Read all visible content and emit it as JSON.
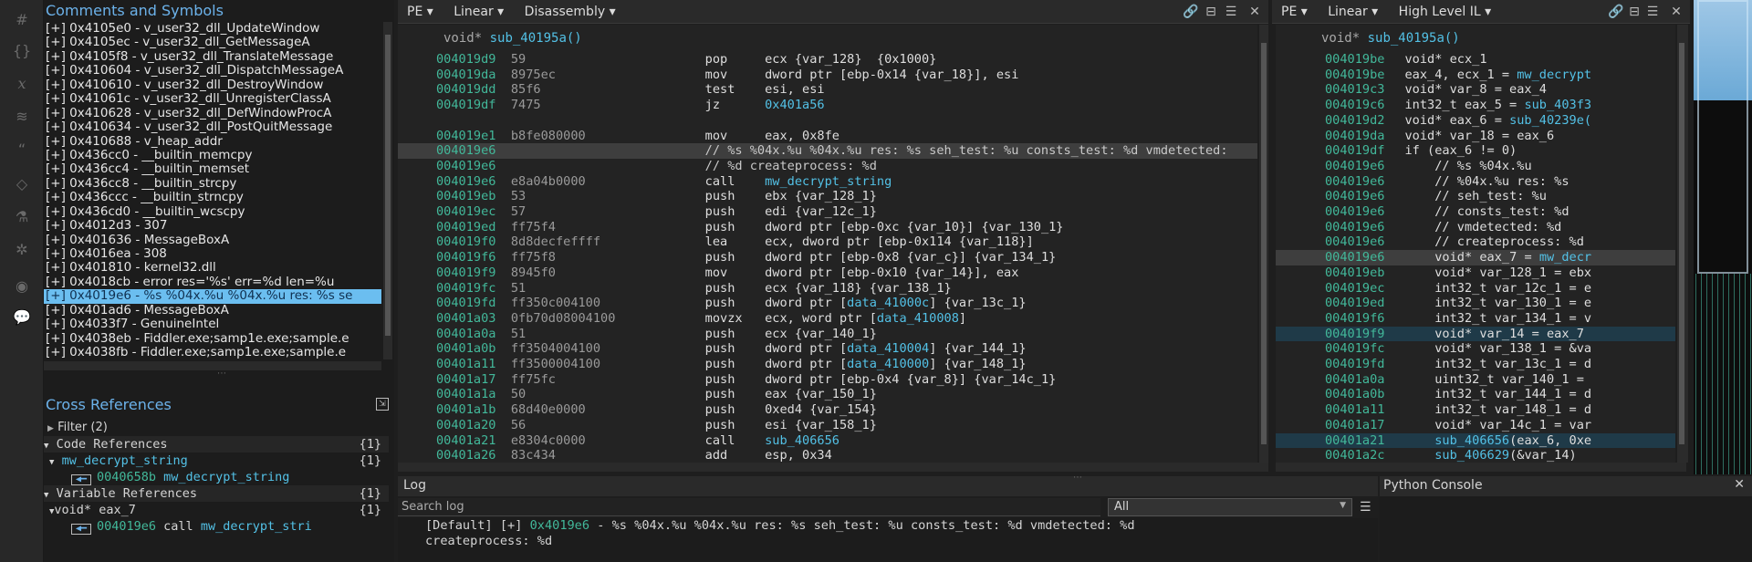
{
  "rail_icons": [
    "#",
    "{}",
    "x",
    "layers",
    "quote",
    "tag",
    "flask",
    "bug",
    "toggle",
    "comment"
  ],
  "comments": {
    "title": "Comments and Symbols",
    "items": [
      "[+] 0x4105e0 - v_user32_dll_UpdateWindow",
      "[+] 0x4105ec - v_user32_dll_GetMessageA",
      "[+] 0x4105f8 - v_user32_dll_TranslateMessage",
      "[+] 0x410604 - v_user32_dll_DispatchMessageA",
      "[+] 0x410610 - v_user32_dll_DestroyWindow",
      "[+] 0x41061c - v_user32_dll_UnregisterClassA",
      "[+] 0x410628 - v_user32_dll_DefWindowProcA",
      "[+] 0x410634 - v_user32_dll_PostQuitMessage",
      "[+] 0x410688 - v_heap_addr",
      "[+] 0x436cc0 - __builtin_memcpy",
      "[+] 0x436cc4 - __builtin_memset",
      "[+] 0x436cc8 - __builtin_strcpy",
      "[+] 0x436ccc - __builtin_strncpy",
      "[+] 0x436cd0 - __builtin_wcscpy",
      "[+] 0x4012d3 - 307",
      "[+] 0x401636 - MessageBoxA",
      "[+] 0x4016ea - 308",
      "[+] 0x401810 - kernel32.dll",
      "[+] 0x4018cb - error res='%s' err=%d len=%u",
      "[+] 0x4019e6 - %s %04x.%u %04x.%u res: %s se",
      "[+] 0x401ad6 - MessageBoxA",
      "[+] 0x4033f7 - GenuineIntel",
      "[+] 0x4038eb - Fiddler.exe;samp1e.exe;sample.e",
      "[+] 0x4038fb - Fiddler.exe;samp1e.exe;sample.e"
    ],
    "selected_index": 19
  },
  "xrefs": {
    "title": "Cross References",
    "filter": "Filter (2)",
    "code_refs_label": "Code References",
    "code_refs_count": "{1}",
    "code_fn": "mw_decrypt_string",
    "code_fn_count": "{1}",
    "code_ref_addr": "0040658b",
    "code_ref_name": "mw_decrypt_string",
    "var_refs_label": "Variable References",
    "var_refs_count": "{1}",
    "var_name": "void* eax_7",
    "var_count": "{1}",
    "var_ref_addr": "004019e6",
    "var_ref_op": "call",
    "var_ref_target": "mw_decrypt_stri"
  },
  "disasm": {
    "menu_pe": "PE ▾",
    "menu_linear": "Linear ▾",
    "menu_view": "Disassembly ▾",
    "signature_kw": "void*",
    "signature_fn": "sub_40195a()",
    "rows": [
      {
        "a": "004019d9",
        "b": "59",
        "m": "pop",
        "o": [
          [
            "ecx {var_128}  {0x1000}",
            ""
          ]
        ]
      },
      {
        "a": "004019da",
        "b": "8975ec",
        "m": "mov",
        "o": [
          [
            "dword ptr [ebp-0x14 {var_18}], esi",
            ""
          ]
        ]
      },
      {
        "a": "004019dd",
        "b": "85f6",
        "m": "test",
        "o": [
          [
            "esi, esi",
            ""
          ]
        ]
      },
      {
        "a": "004019df",
        "b": "7475",
        "m": "jz",
        "o": [
          [
            "0x401a56",
            "cyan"
          ]
        ]
      },
      {
        "a": "",
        "b": "",
        "m": "",
        "o": []
      },
      {
        "a": "004019e1",
        "b": "b8fe080000",
        "m": "mov",
        "o": [
          [
            "eax, 0x8fe",
            ""
          ]
        ]
      },
      {
        "a": "004019e6",
        "b": "",
        "m": "",
        "o": [
          [
            "// %s %04x.%u %04x.%u res: %s seh_test: %u consts_test: %d vmdetected:",
            "cmt"
          ]
        ],
        "hl": "hl"
      },
      {
        "a": "004019e6",
        "b": "",
        "m": "",
        "o": [
          [
            "// %d createprocess: %d",
            "cmt"
          ]
        ]
      },
      {
        "a": "004019e6",
        "b": "e8a04b0000",
        "m": "call",
        "o": [
          [
            "mw_decrypt_string",
            "cyan"
          ]
        ]
      },
      {
        "a": "004019eb",
        "b": "53",
        "m": "push",
        "o": [
          [
            "ebx {var_128_1}",
            ""
          ]
        ]
      },
      {
        "a": "004019ec",
        "b": "57",
        "m": "push",
        "o": [
          [
            "edi {var_12c_1}",
            ""
          ]
        ]
      },
      {
        "a": "004019ed",
        "b": "ff75f4",
        "m": "push",
        "o": [
          [
            "dword ptr [ebp-0xc {var_10}] {var_130_1}",
            ""
          ]
        ]
      },
      {
        "a": "004019f0",
        "b": "8d8decfeffff",
        "m": "lea",
        "o": [
          [
            "ecx, dword ptr [ebp-0x114 {var_118}]",
            ""
          ]
        ]
      },
      {
        "a": "004019f6",
        "b": "ff75f8",
        "m": "push",
        "o": [
          [
            "dword ptr [ebp-0x8 {var_c}] {var_134_1}",
            ""
          ]
        ]
      },
      {
        "a": "004019f9",
        "b": "8945f0",
        "m": "mov",
        "o": [
          [
            "dword ptr [ebp-0x10 {var_14}], eax",
            ""
          ]
        ]
      },
      {
        "a": "004019fc",
        "b": "51",
        "m": "push",
        "o": [
          [
            "ecx {var_118} {var_138_1}",
            ""
          ]
        ]
      },
      {
        "a": "004019fd",
        "b": "ff350c004100",
        "m": "push",
        "o": [
          [
            "dword ptr [",
            ""
          ],
          [
            "data_41000c",
            "cyan"
          ],
          [
            "] {var_13c_1}",
            ""
          ]
        ]
      },
      {
        "a": "00401a03",
        "b": "0fb70d08004100",
        "m": "movzx",
        "o": [
          [
            "ecx, word ptr [",
            ""
          ],
          [
            "data_410008",
            "cyan"
          ],
          [
            "]",
            ""
          ]
        ]
      },
      {
        "a": "00401a0a",
        "b": "51",
        "m": "push",
        "o": [
          [
            "ecx {var_140_1}",
            ""
          ]
        ]
      },
      {
        "a": "00401a0b",
        "b": "ff3504004100",
        "m": "push",
        "o": [
          [
            "dword ptr [",
            ""
          ],
          [
            "data_410004",
            "cyan"
          ],
          [
            "] {var_144_1}",
            ""
          ]
        ]
      },
      {
        "a": "00401a11",
        "b": "ff3500004100",
        "m": "push",
        "o": [
          [
            "dword ptr [",
            ""
          ],
          [
            "data_410000",
            "cyan"
          ],
          [
            "] {var_148_1}",
            ""
          ]
        ]
      },
      {
        "a": "00401a17",
        "b": "ff75fc",
        "m": "push",
        "o": [
          [
            "dword ptr [ebp-0x4 {var_8}] {var_14c_1}",
            ""
          ]
        ]
      },
      {
        "a": "00401a1a",
        "b": "50",
        "m": "push",
        "o": [
          [
            "eax {var_150_1}",
            ""
          ]
        ]
      },
      {
        "a": "00401a1b",
        "b": "68d40e0000",
        "m": "push",
        "o": [
          [
            "0xed4 {var_154}",
            ""
          ]
        ]
      },
      {
        "a": "00401a20",
        "b": "56",
        "m": "push",
        "o": [
          [
            "esi {var_158_1}",
            ""
          ]
        ]
      },
      {
        "a": "00401a21",
        "b": "e8304c0000",
        "m": "call",
        "o": [
          [
            "sub_406656",
            "cyan"
          ]
        ]
      },
      {
        "a": "00401a26",
        "b": "83c434",
        "m": "add",
        "o": [
          [
            "esp, 0x34",
            ""
          ]
        ]
      }
    ]
  },
  "hlil": {
    "menu_pe": "PE ▾",
    "menu_linear": "Linear ▾",
    "menu_view": "High Level IL ▾",
    "signature_kw": "void*",
    "signature_fn": "sub_40195a()",
    "rows": [
      {
        "a": "004019be",
        "t": [
          [
            "void* ecx_1",
            ""
          ]
        ],
        "i": 0
      },
      {
        "a": "004019be",
        "t": [
          [
            "eax_4, ecx_1 = ",
            ""
          ],
          [
            "mw_decrypt",
            "cyan"
          ]
        ],
        "i": 0
      },
      {
        "a": "004019c3",
        "t": [
          [
            "void* var_8 = eax_4",
            ""
          ]
        ],
        "i": 0
      },
      {
        "a": "004019c6",
        "t": [
          [
            "int32_t eax_5 = ",
            ""
          ],
          [
            "sub_403f3",
            "cyan"
          ]
        ],
        "i": 0
      },
      {
        "a": "004019d2",
        "t": [
          [
            "void* eax_6 = ",
            ""
          ],
          [
            "sub_40239e(",
            "cyan"
          ]
        ],
        "i": 0
      },
      {
        "a": "004019da",
        "t": [
          [
            "void* var_18 = eax_6",
            ""
          ]
        ],
        "i": 0
      },
      {
        "a": "004019df",
        "t": [
          [
            "if (eax_6 != 0)",
            ""
          ]
        ],
        "i": 0
      },
      {
        "a": "004019e6",
        "t": [
          [
            "// %s %04x.%u",
            ""
          ]
        ],
        "i": 1
      },
      {
        "a": "004019e6",
        "t": [
          [
            "// %04x.%u res: %s",
            ""
          ]
        ],
        "i": 1
      },
      {
        "a": "004019e6",
        "t": [
          [
            "// seh_test: %u",
            ""
          ]
        ],
        "i": 1
      },
      {
        "a": "004019e6",
        "t": [
          [
            "// consts_test: %d",
            ""
          ]
        ],
        "i": 1
      },
      {
        "a": "004019e6",
        "t": [
          [
            "// vmdetected: %d",
            ""
          ]
        ],
        "i": 1
      },
      {
        "a": "004019e6",
        "t": [
          [
            "// createprocess: %d",
            ""
          ]
        ],
        "i": 1
      },
      {
        "a": "004019e6",
        "t": [
          [
            "void* eax_7 = ",
            ""
          ],
          [
            "mw_decr",
            "cyan"
          ]
        ],
        "i": 1,
        "hl": "hl"
      },
      {
        "a": "004019eb",
        "t": [
          [
            "void* var_128_1 = ebx",
            ""
          ]
        ],
        "i": 1
      },
      {
        "a": "004019ec",
        "t": [
          [
            "int32_t var_12c_1 = e",
            ""
          ]
        ],
        "i": 1
      },
      {
        "a": "004019ed",
        "t": [
          [
            "int32_t var_130_1 = e",
            ""
          ]
        ],
        "i": 1
      },
      {
        "a": "004019f6",
        "t": [
          [
            "int32_t var_134_1 = v",
            ""
          ]
        ],
        "i": 1
      },
      {
        "a": "004019f9",
        "t": [
          [
            "void* var_14 = eax_7",
            ""
          ]
        ],
        "i": 1,
        "hl": "hlb"
      },
      {
        "a": "004019fc",
        "t": [
          [
            "void* var_138_1 = &va",
            ""
          ]
        ],
        "i": 1
      },
      {
        "a": "004019fd",
        "t": [
          [
            "int32_t var_13c_1 = d",
            ""
          ]
        ],
        "i": 1
      },
      {
        "a": "00401a0a",
        "t": [
          [
            "uint32_t var_140_1 = ",
            ""
          ]
        ],
        "i": 1
      },
      {
        "a": "00401a0b",
        "t": [
          [
            "int32_t var_144_1 = d",
            ""
          ]
        ],
        "i": 1
      },
      {
        "a": "00401a11",
        "t": [
          [
            "int32_t var_148_1 = d",
            ""
          ]
        ],
        "i": 1
      },
      {
        "a": "00401a17",
        "t": [
          [
            "void* var_14c_1 = var",
            ""
          ]
        ],
        "i": 1
      },
      {
        "a": "00401a21",
        "t": [
          [
            "sub_406656",
            "cyan"
          ],
          [
            "(eax_6, 0xe",
            ""
          ]
        ],
        "i": 1,
        "hl": "hlb"
      },
      {
        "a": "00401a2c",
        "t": [
          [
            "sub_406629",
            "cyan"
          ],
          [
            "(&var_14)",
            ""
          ]
        ],
        "i": 1
      }
    ]
  },
  "log": {
    "title": "Log",
    "search_placeholder": "Search log",
    "filter_value": "All",
    "line1_prefix": "[Default] [+] ",
    "line1_addr": "0x4019e6",
    "line1_rest": " - %s %04x.%u %04x.%u res: %s seh_test: %u consts_test: %d vmdetected: %d",
    "line2": "createprocess: %d"
  },
  "python": {
    "title": "Python Console"
  },
  "colors": {
    "accent_blue": "#6cb2ea",
    "address_green": "#42b89a",
    "symbol_cyan": "#53c1e6",
    "selection": "#6bbef0"
  }
}
